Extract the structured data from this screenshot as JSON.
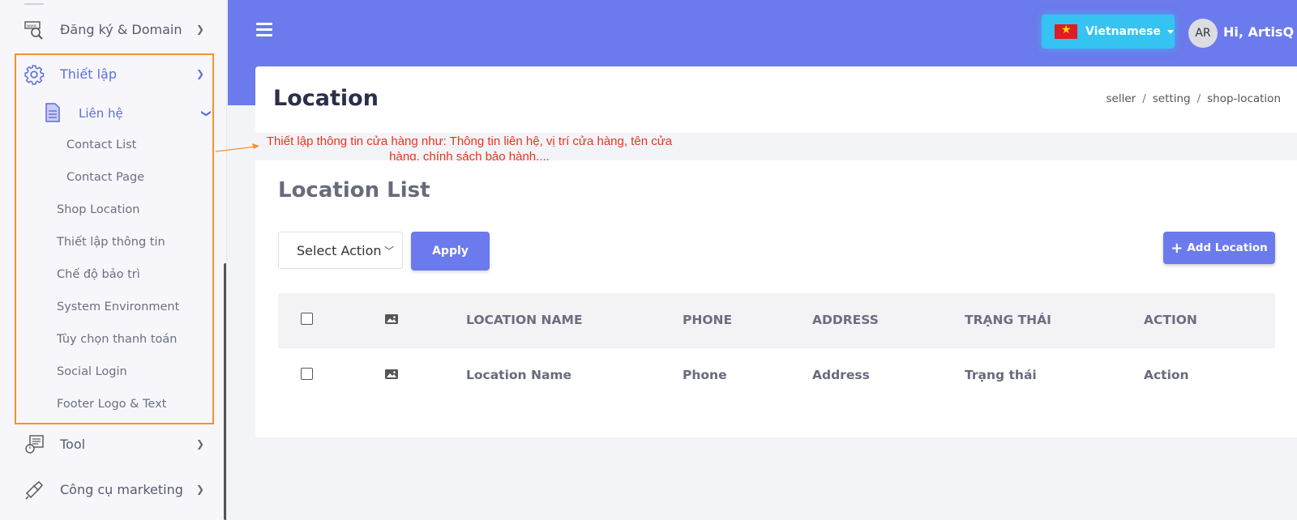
{
  "sidebar": {
    "items": [
      {
        "label": "Đăng ký & Domain"
      },
      {
        "label": "Thiết lập"
      },
      {
        "label": "Tool"
      },
      {
        "label": "Công cụ marketing"
      }
    ],
    "sub_group": "Liên hệ",
    "contact_items": [
      "Contact List",
      "Contact Page"
    ],
    "setting_items": [
      "Shop Location",
      "Thiết lập thông tin",
      "Chế độ bảo trì",
      "System Environment",
      "Tùy chọn thanh toán",
      "Social Login",
      "Footer Logo & Text"
    ]
  },
  "header": {
    "language": "Vietnamese",
    "avatar_initials": "AR",
    "greeting": "Hi, ArtisQ"
  },
  "page": {
    "title": "Location",
    "breadcrumb": [
      "seller",
      "setting",
      "shop-location"
    ]
  },
  "annotation": "Thiết lập thông tin cửa hàng như: Thông tin liên hệ, vị trí cửa hàng, tên cửa hàng, chính sách bảo hành,...",
  "list": {
    "title": "Location List",
    "select_action": "Select Action",
    "apply": "Apply",
    "add": "Add Location",
    "columns": [
      "LOCATION NAME",
      "PHONE",
      "ADDRESS",
      "TRẠNG THÁI",
      "ACTION"
    ],
    "rows": [
      [
        "Location Name",
        "Phone",
        "Address",
        "Trạng thái",
        "Action"
      ]
    ]
  },
  "colors": {
    "primary": "#6b7aec",
    "lang_button": "#35c3f1",
    "highlight": "#f5922a",
    "annotation": "#e8351c"
  }
}
